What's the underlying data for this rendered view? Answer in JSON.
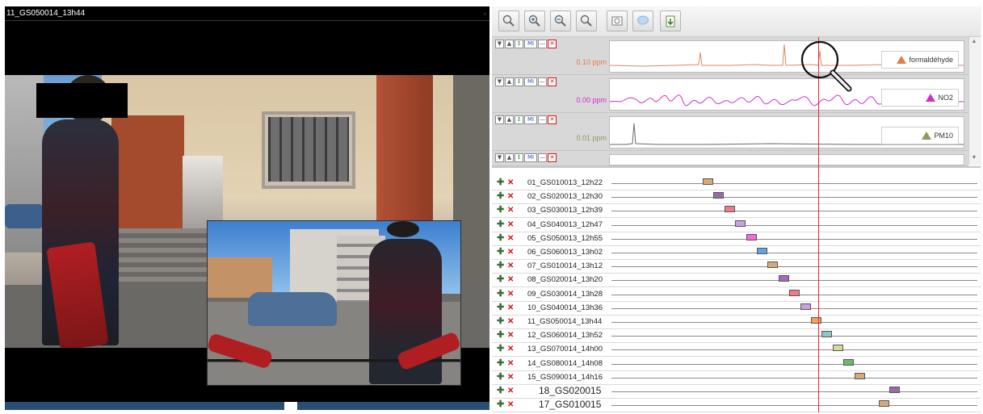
{
  "video": {
    "title": "11_GS050014_13h44",
    "building_number": "11"
  },
  "toolbar": {
    "buttons": [
      {
        "name": "zoom-fit-icon"
      },
      {
        "name": "zoom-in-icon"
      },
      {
        "name": "zoom-out-icon"
      },
      {
        "name": "zoom-reset-icon"
      },
      {
        "name": "screenshot-icon"
      },
      {
        "name": "comment-icon"
      },
      {
        "name": "export-icon"
      }
    ]
  },
  "sensors": [
    {
      "value": "0.10 ppm",
      "legend": "formaldéhyde",
      "color": "#e07f45",
      "line_color": "#d88a64"
    },
    {
      "value": "0.00 ppm",
      "legend": "NO2",
      "color": "#d02bd0",
      "line_color": "#cf2ecf"
    },
    {
      "value": "0.01 ppm",
      "legend": "PM10",
      "color": "#8a9a5b",
      "line_color": "#6a6a6a"
    },
    {
      "value": "",
      "legend": "",
      "color": "#888888",
      "line_color": "#777777"
    }
  ],
  "sensor_controls": {
    "down": "▼",
    "up": "▲",
    "move": "↕",
    "mi": "MI",
    "minus": "—",
    "close": "✕"
  },
  "clips": [
    {
      "label": "01_GS010013_12h22",
      "color": "#d9a87a"
    },
    {
      "label": "02_GS020013_12h30",
      "color": "#9a6aa8"
    },
    {
      "label": "03_GS030013_12h39",
      "color": "#f07a88"
    },
    {
      "label": "04_GS040013_12h47",
      "color": "#c9a0e0"
    },
    {
      "label": "05_GS050013_12h55",
      "color": "#f26bd8"
    },
    {
      "label": "06_GS060013_13h02",
      "color": "#5ea6e0"
    },
    {
      "label": "07_GS010014_13h12",
      "color": "#d9a87a"
    },
    {
      "label": "08_GS020014_13h20",
      "color": "#a86ab6"
    },
    {
      "label": "09_GS030014_13h28",
      "color": "#f07a88"
    },
    {
      "label": "10_GS040014_13h36",
      "color": "#c9a0e0"
    },
    {
      "label": "11_GS050014_13h44",
      "color": "#f5a060"
    },
    {
      "label": "12_GS060014_13h52",
      "color": "#8ec7c7"
    },
    {
      "label": "13_GS070014_14h00",
      "color": "#d7d79b"
    },
    {
      "label": "14_GS080014_14h08",
      "color": "#6db86d"
    },
    {
      "label": "15_GS090014_14h16",
      "color": "#d9a87a"
    },
    {
      "label": "18_GS020015",
      "color": "#9a6aa8"
    },
    {
      "label": "17_GS010015",
      "color": "#d9a87a"
    }
  ],
  "clip_controls": {
    "add": "✚",
    "remove": "✕"
  }
}
